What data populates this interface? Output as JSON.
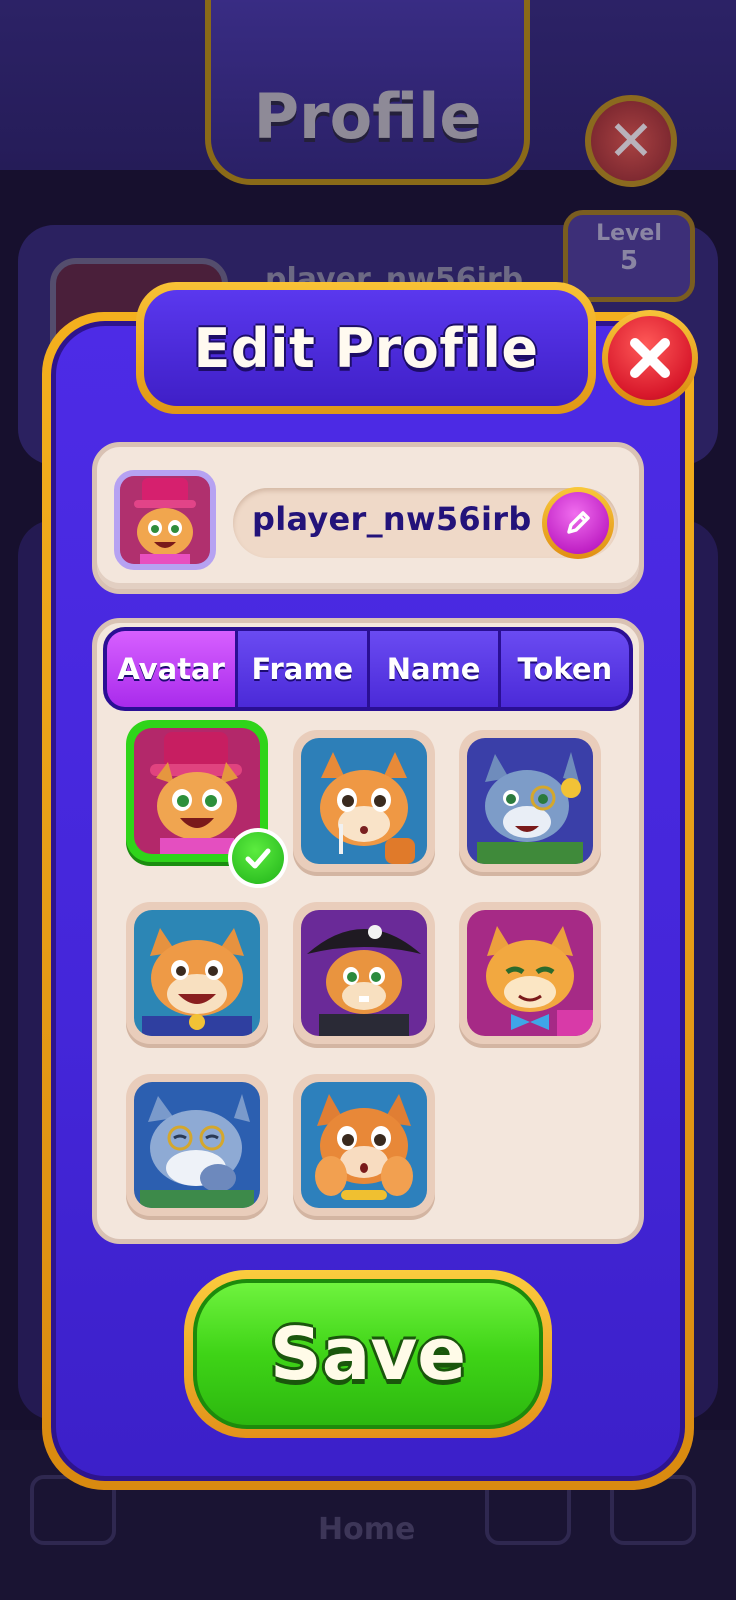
{
  "background": {
    "title": "Profile",
    "player_name": "player_nw56irb",
    "level_label": "Level",
    "level_value": "5",
    "nav_home_label": "Home"
  },
  "dialog": {
    "title": "Edit Profile",
    "close_icon": "close-icon",
    "player_name": "player_nw56irb",
    "edit_icon": "pencil-icon",
    "tabs": [
      "Avatar",
      "Frame",
      "Name",
      "Token"
    ],
    "active_tab": "Avatar",
    "avatars": [
      {
        "name": "top-hat-cat",
        "selected": true
      },
      {
        "name": "candy-cat",
        "selected": false
      },
      {
        "name": "monocle-coin-cat",
        "selected": false
      },
      {
        "name": "medal-cat",
        "selected": false
      },
      {
        "name": "pirate-cat",
        "selected": false
      },
      {
        "name": "bowtie-cat",
        "selected": false
      },
      {
        "name": "thinking-cat",
        "selected": false
      },
      {
        "name": "shy-cat",
        "selected": false
      }
    ],
    "save_label": "Save"
  },
  "colors": {
    "dialog_fill": "#4426d9",
    "gold_border": "#f4b01e",
    "active_tab": "#c246f5",
    "save_green": "#3fd417",
    "close_red": "#e0202f"
  }
}
